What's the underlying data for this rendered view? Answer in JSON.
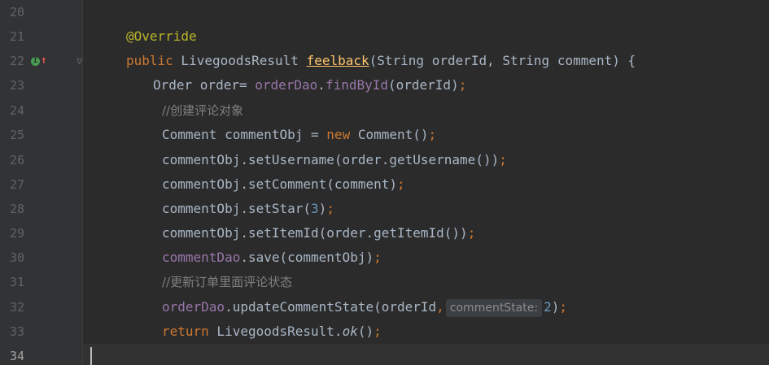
{
  "gutter": {
    "line_numbers": [
      "20",
      "21",
      "22",
      "23",
      "24",
      "25",
      "26",
      "27",
      "28",
      "29",
      "30",
      "31",
      "32",
      "33",
      "34"
    ],
    "current_line": "34",
    "line22_icons": [
      "implements-icon",
      "override-arrow-icon"
    ]
  },
  "code": {
    "line21": {
      "annotation": "@Override"
    },
    "line22": {
      "kw_public": "public",
      "return_type": " LivegoodsResult ",
      "method": "feelback",
      "params": "(String orderId, String comment) {"
    },
    "line23": {
      "decl": "Order order= ",
      "field": "orderDao",
      "dot": ".",
      "call": "findById",
      "args": "(orderId)",
      "semi": ";"
    },
    "line24": {
      "comment": "//创建评论对象"
    },
    "line25": {
      "decl": "Comment commentObj = ",
      "kw_new": "new",
      "rest": " Comment()",
      "semi": ";"
    },
    "line26": {
      "stmt": "commentObj.setUsername(order.getUsername())",
      "semi": ";"
    },
    "line27": {
      "stmt": "commentObj.setComment(comment)",
      "semi": ";"
    },
    "line28": {
      "prefix": "commentObj.setStar(",
      "num": "3",
      "suffix": ")",
      "semi": ";"
    },
    "line29": {
      "stmt": "commentObj.setItemId(order.getItemId())",
      "semi": ";"
    },
    "line30": {
      "field": "commentDao",
      "rest": ".save(commentObj)",
      "semi": ";"
    },
    "line31": {
      "comment": "//更新订单里面评论状态"
    },
    "line32": {
      "field": "orderDao",
      "rest": ".updateCommentState(orderId",
      "comma": ",",
      "hint": "commentState:",
      "num": "2",
      "suffix": ")",
      "semi": ";"
    },
    "line33": {
      "kw_return": "return",
      "rest": " LivegoodsResult.",
      "static_call": "ok",
      "suffix": "()",
      "semi": ";"
    }
  }
}
